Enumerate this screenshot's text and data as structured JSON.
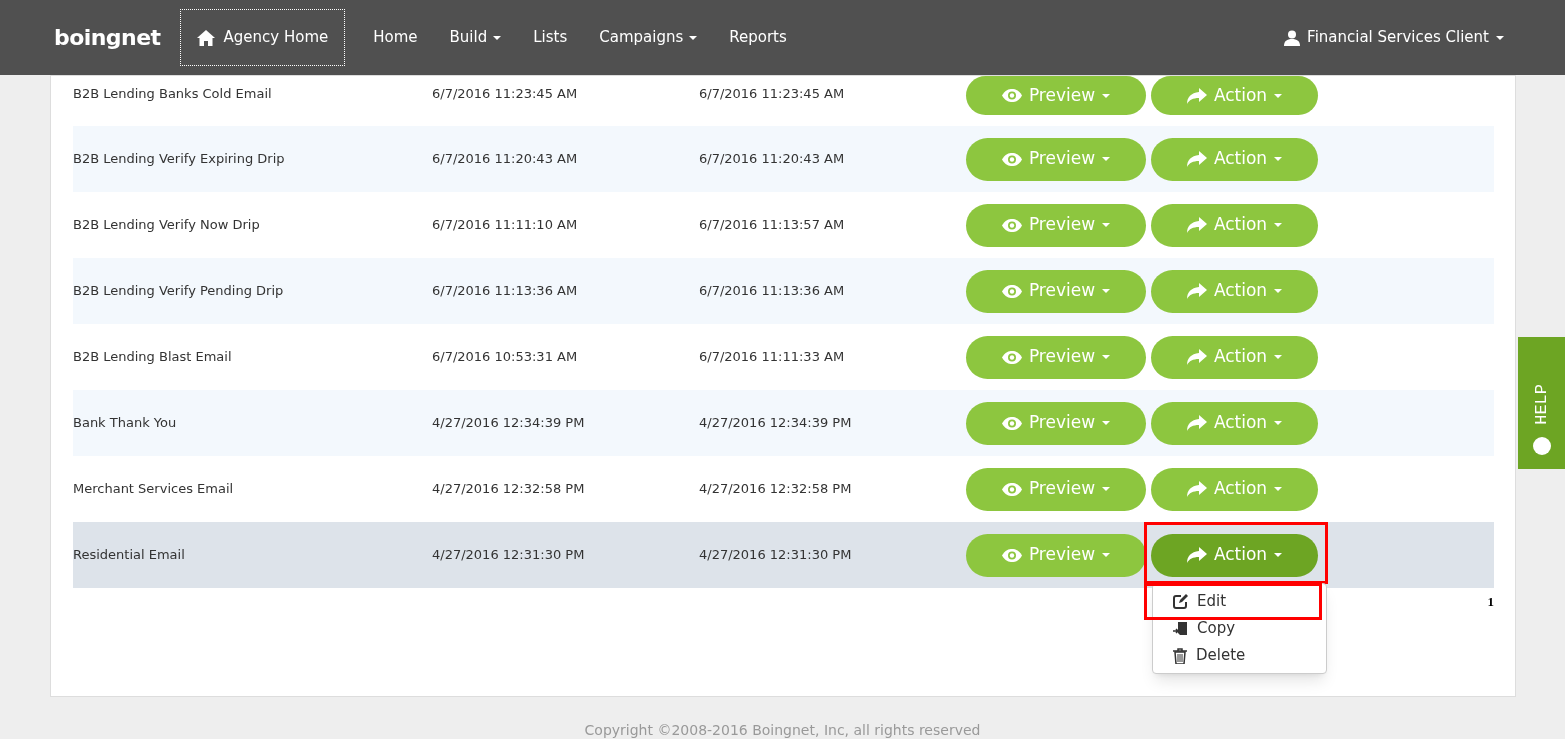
{
  "nav": {
    "logo": "boingnet",
    "agency_home": "Agency Home",
    "items": [
      {
        "label": "Home",
        "dropdown": false
      },
      {
        "label": "Build",
        "dropdown": true
      },
      {
        "label": "Lists",
        "dropdown": false
      },
      {
        "label": "Campaigns",
        "dropdown": true
      },
      {
        "label": "Reports",
        "dropdown": false
      }
    ],
    "user": "Financial Services Client"
  },
  "table": {
    "rows": [
      {
        "name": "B2B Lending Banks Cold Email",
        "created": "6/7/2016 11:23:45 AM",
        "modified": "6/7/2016 11:23:45 AM",
        "preview": "Preview",
        "action": "Action",
        "selected": false
      },
      {
        "name": "B2B Lending Verify Expiring Drip",
        "created": "6/7/2016 11:20:43 AM",
        "modified": "6/7/2016 11:20:43 AM",
        "preview": "Preview",
        "action": "Action",
        "selected": false
      },
      {
        "name": "B2B Lending Verify Now Drip",
        "created": "6/7/2016 11:11:10 AM",
        "modified": "6/7/2016 11:13:57 AM",
        "preview": "Preview",
        "action": "Action",
        "selected": false
      },
      {
        "name": "B2B Lending Verify Pending Drip",
        "created": "6/7/2016 11:13:36 AM",
        "modified": "6/7/2016 11:13:36 AM",
        "preview": "Preview",
        "action": "Action",
        "selected": false
      },
      {
        "name": "B2B Lending Blast Email",
        "created": "6/7/2016 10:53:31 AM",
        "modified": "6/7/2016 11:11:33 AM",
        "preview": "Preview",
        "action": "Action",
        "selected": false
      },
      {
        "name": "Bank Thank You",
        "created": "4/27/2016 12:34:39 PM",
        "modified": "4/27/2016 12:34:39 PM",
        "preview": "Preview",
        "action": "Action",
        "selected": false
      },
      {
        "name": "Merchant Services Email",
        "created": "4/27/2016 12:32:58 PM",
        "modified": "4/27/2016 12:32:58 PM",
        "preview": "Preview",
        "action": "Action",
        "selected": false
      },
      {
        "name": "Residential Email",
        "created": "4/27/2016 12:31:30 PM",
        "modified": "4/27/2016 12:31:30 PM",
        "preview": "Preview",
        "action": "Action",
        "selected": true
      }
    ]
  },
  "action_menu": {
    "items": [
      {
        "kind": "edit",
        "label": "Edit",
        "highlighted": true
      },
      {
        "kind": "copy",
        "label": "Copy",
        "highlighted": false
      },
      {
        "kind": "delete",
        "label": "Delete",
        "highlighted": false
      }
    ]
  },
  "pagination": {
    "pages": [
      "1"
    ]
  },
  "help_tab": "HELP",
  "footer": "Copyright ©2008-2016 Boingnet, Inc, all rights reserved"
}
